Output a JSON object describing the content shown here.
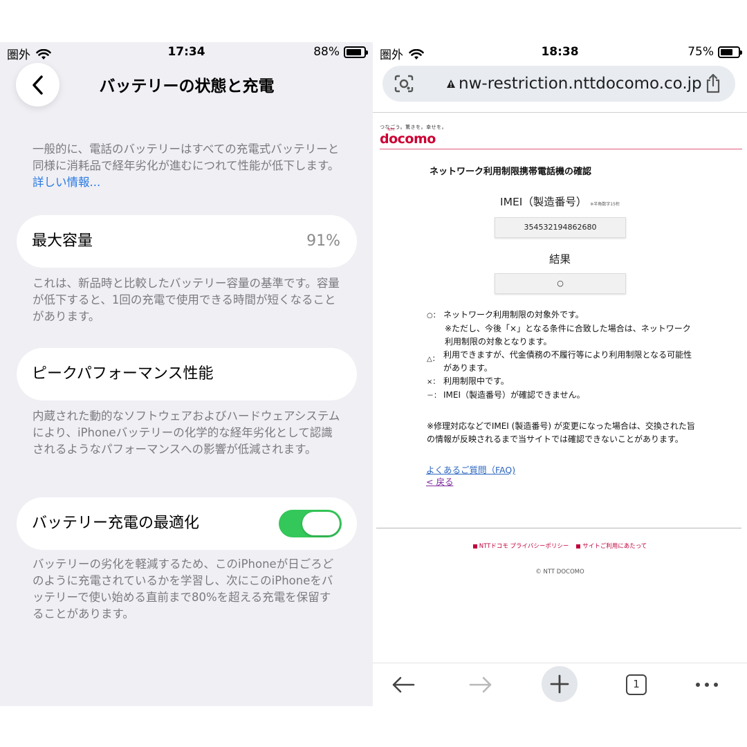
{
  "left": {
    "status": {
      "carrier": "圏外",
      "time": "17:34",
      "battery": "88%",
      "battery_level": 0.88
    },
    "title": "バッテリーの状態と充電",
    "intro": {
      "text": "一般的に、電話のバッテリーはすべての充電式バッテリーと同様に消耗品で経年劣化が進むにつれて性能が低下します。",
      "link": "詳しい情報..."
    },
    "max_capacity": {
      "label": "最大容量",
      "value": "91%",
      "note": "これは、新品時と比較したバッテリー容量の基準です。容量が低下すると、1回の充電で使用できる時間が短くなることがあります。"
    },
    "peak": {
      "label": "ピークパフォーマンス性能",
      "note": "内蔵された動的なソフトウェアおよびハードウェアシステムにより、iPhoneバッテリーの化学的な経年劣化として認識されるようなパフォーマンスへの影響が低減されます。"
    },
    "optimized": {
      "label": "バッテリー充電の最適化",
      "enabled": true,
      "note": "バッテリーの劣化を軽減するため、このiPhoneが日ごろどのように充電されているかを学習し、次にこのiPhoneをバッテリーで使い始める直前まで80%を超える充電を保留することがあります。"
    }
  },
  "right": {
    "status": {
      "carrier": "圏外",
      "time": "18:38",
      "battery": "75%",
      "battery_level": 0.75
    },
    "url": "nw-restriction.nttdocomo.co.jp",
    "brand": {
      "tagline": "つなごう。驚きを。幸せを。",
      "ntt": "NTT",
      "logo": "docomo"
    },
    "page_title": "ネットワーク利用制限携帯電話機の確認",
    "imei_label": "IMEI（製造番号）",
    "imei_note": "※半角数字15桁",
    "imei_value": "354532194862680",
    "result_label": "結果",
    "result_value": "○",
    "legend": [
      {
        "sym": "○：",
        "text": "ネットワーク利用制限の対象外です。"
      },
      {
        "sym": "",
        "text": "※ただし、今後「×」となる条件に合致した場合は、ネットワーク利用制限の対象となります。"
      },
      {
        "sym": "△：",
        "text": "利用できますが、代金債務の不履行等により利用制限となる可能性があります。"
      },
      {
        "sym": "×：",
        "text": "利用制限中です。"
      },
      {
        "sym": "－：",
        "text": "IMEI（製造番号）が確認できません。"
      }
    ],
    "repair_note": "※修理対応などでIMEI (製造番号) が変更になった場合は、交換された旨の情報が反映されるまで当サイトでは確認できないことがあります。",
    "faq_link": "よくあるご質問（FAQ)",
    "back_link": "< 戻る",
    "footer_links": [
      "NTTドコモ プライバシーポリシー",
      "サイトご利用にあたって"
    ],
    "copyright": "© NTT DOCOMO",
    "tab_count": "1"
  }
}
